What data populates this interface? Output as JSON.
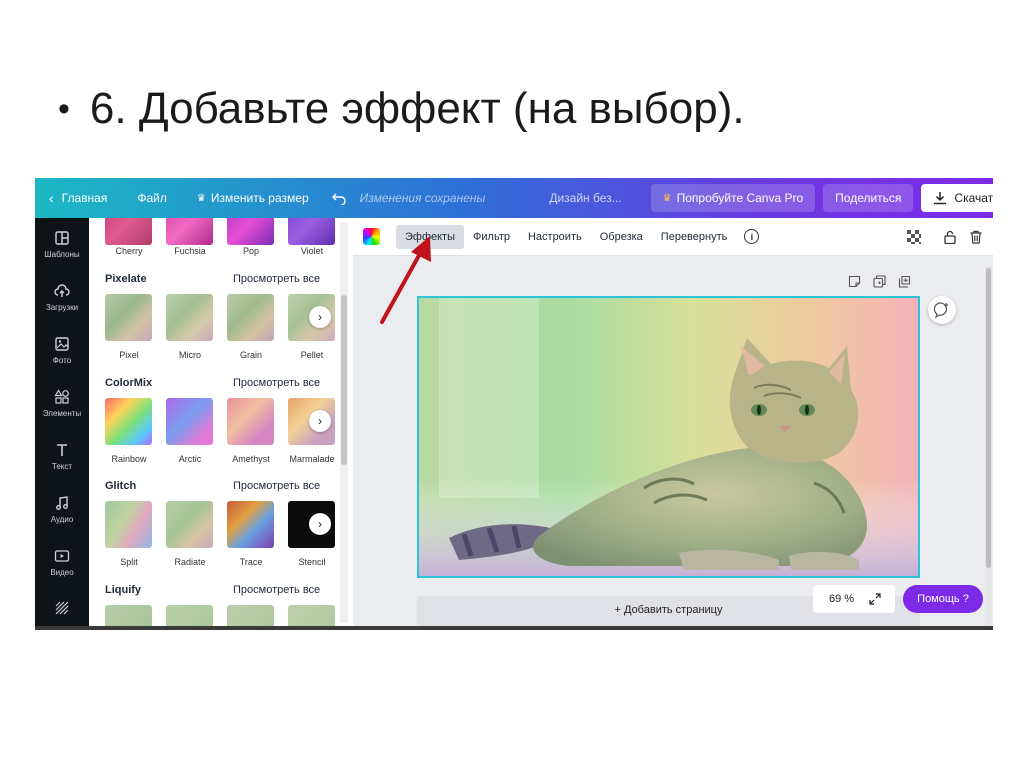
{
  "slide": {
    "bullet": "•",
    "title": "6. Добавьте эффект (на выбор)."
  },
  "topbar": {
    "home": "Главная",
    "file": "Файл",
    "resize": "Изменить размер",
    "saved": "Изменения сохранены",
    "design": "Дизайн без...",
    "pro": "Попробуйте Canva Pro",
    "share": "Поделиться",
    "download": "Скачать",
    "more": "•••"
  },
  "sidebar": {
    "items": [
      {
        "label": "Шаблоны",
        "icon": "templates-icon"
      },
      {
        "label": "Загрузки",
        "icon": "upload-cloud-icon"
      },
      {
        "label": "Фото",
        "icon": "photo-icon"
      },
      {
        "label": "Элементы",
        "icon": "elements-icon"
      },
      {
        "label": "Текст",
        "icon": "text-icon"
      },
      {
        "label": "Аудио",
        "icon": "music-icon"
      },
      {
        "label": "Видео",
        "icon": "video-icon"
      },
      {
        "label": "",
        "icon": "pattern-icon"
      }
    ]
  },
  "panel": {
    "top_row": [
      "Cherry",
      "Fuchsia",
      "Pop",
      "Violet"
    ],
    "categories": [
      {
        "title": "Pixelate",
        "see_all": "Просмотреть все",
        "items": [
          "Pixel",
          "Micro",
          "Grain",
          "Pellet"
        ]
      },
      {
        "title": "ColorMix",
        "see_all": "Просмотреть все",
        "items": [
          "Rainbow",
          "Arctic",
          "Amethyst",
          "Marmalade"
        ]
      },
      {
        "title": "Glitch",
        "see_all": "Просмотреть все",
        "items": [
          "Split",
          "Radiate",
          "Trace",
          "Stencil"
        ]
      },
      {
        "title": "Liquify",
        "see_all": "Просмотреть все",
        "items": []
      }
    ],
    "next_glyph": "›"
  },
  "toolbar": {
    "effects": "Эффекты",
    "filter": "Фильтр",
    "adjust": "Настроить",
    "crop": "Обрезка",
    "flip": "Перевернуть",
    "info": "i"
  },
  "canvas": {
    "add_page": "+ Добавить страницу",
    "zoom": "69 %",
    "help": "Помощь ?"
  },
  "colors": {
    "accent": "#7d2ae8",
    "selection": "#2bc4d8",
    "arrow": "#c0141c"
  }
}
